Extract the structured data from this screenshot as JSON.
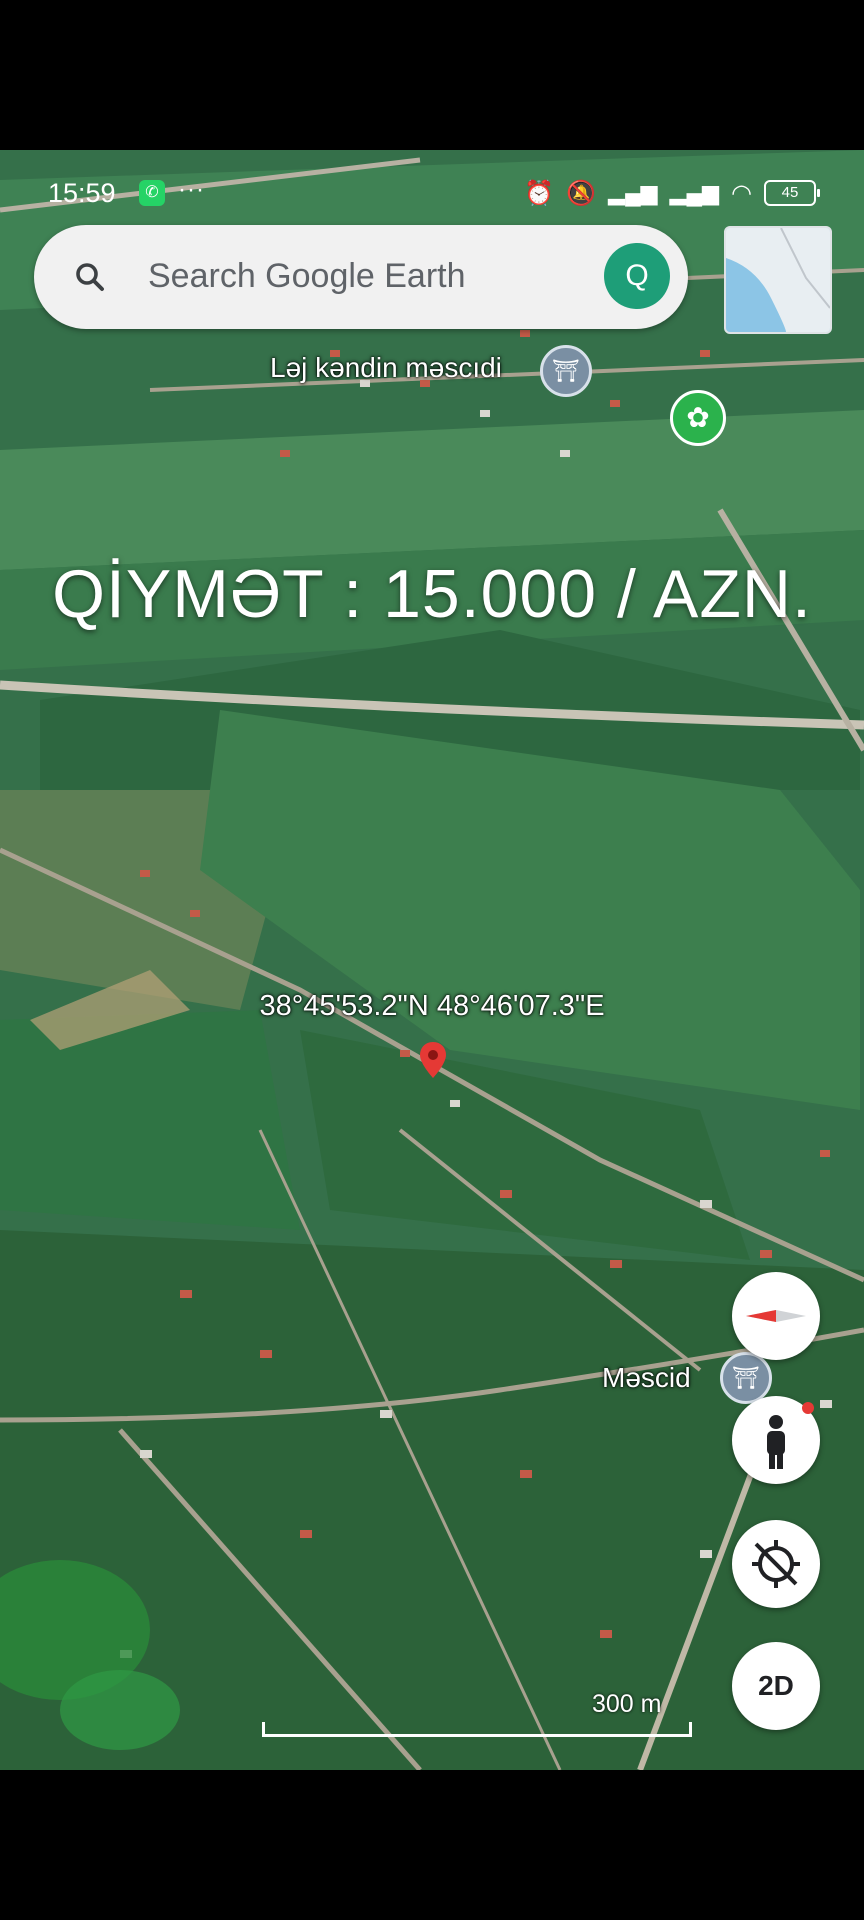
{
  "status_bar": {
    "time": "15:59",
    "overflow": "···",
    "battery": "45",
    "icons": [
      "whatsapp-icon",
      "alarm-icon",
      "mute-icon",
      "signal-icon",
      "signal-icon",
      "wifi-icon",
      "battery-icon"
    ]
  },
  "search": {
    "placeholder": "Search Google Earth",
    "avatar_letter": "Q",
    "accent": "#1e9e78"
  },
  "map": {
    "overlay_price": "QİYMƏT : 15.000 / AZN.",
    "coordinates": "38°45'53.2\"N 48°46'07.3\"E",
    "poi_1": "Ləj kəndin məscıdi",
    "poi_2": "Məscid",
    "scale": "300 m"
  },
  "controls": {
    "view_mode": "2D",
    "icons": [
      "compass-icon",
      "street-view-icon",
      "location-off-icon"
    ]
  }
}
